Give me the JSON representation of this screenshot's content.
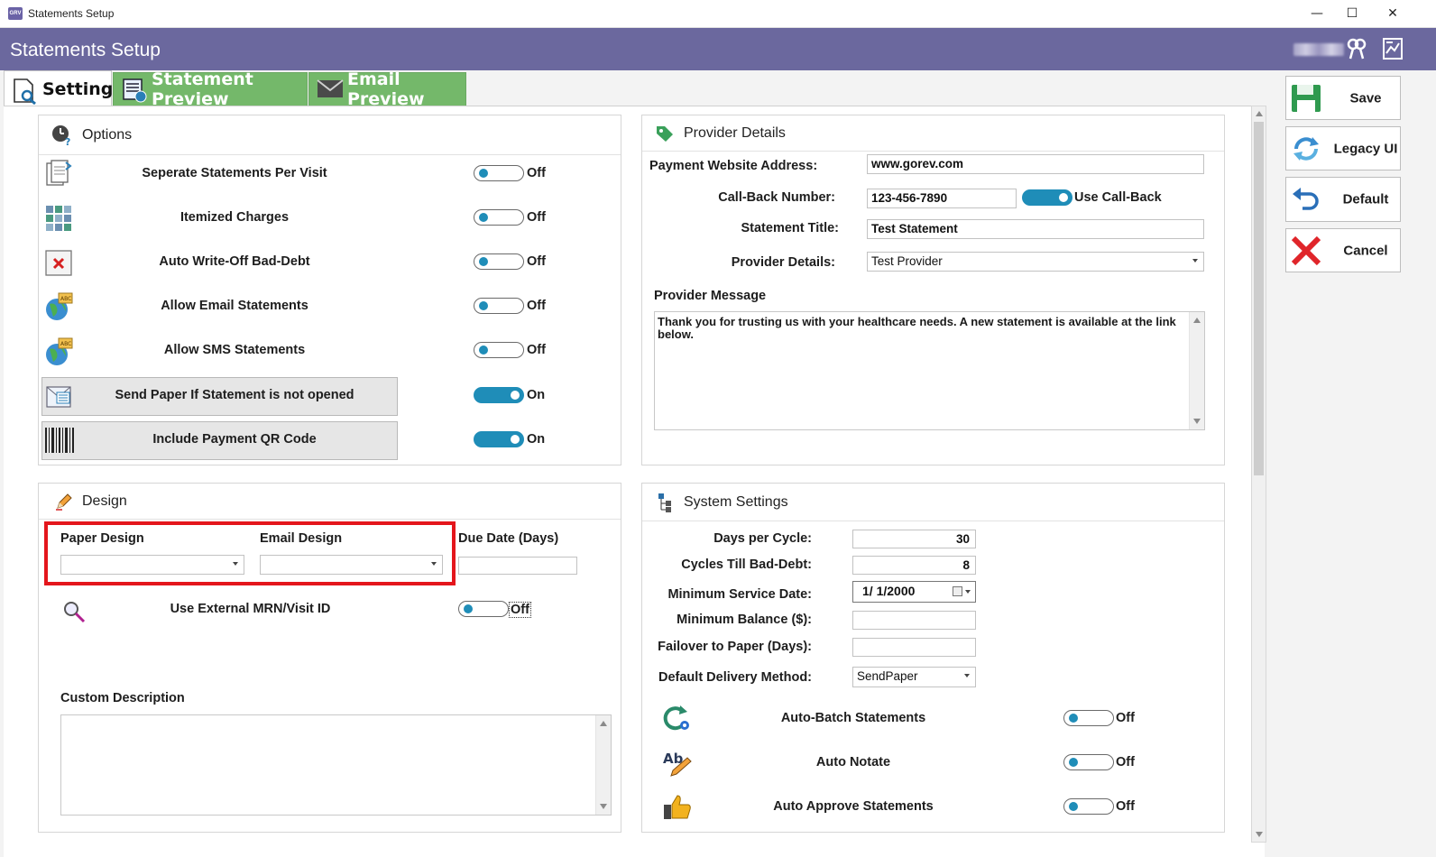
{
  "window": {
    "title": "Statements Setup",
    "app_icon_text": "GRV",
    "minimize": "—",
    "maximize": "☐",
    "close": "✕"
  },
  "header": {
    "title": "Statements Setup"
  },
  "tabs": [
    {
      "label": "Settings"
    },
    {
      "label": "Statement Preview"
    },
    {
      "label": "Email Preview"
    }
  ],
  "options": {
    "title": "Options",
    "rows": [
      {
        "label": "Seperate Statements Per Visit",
        "state": "Off",
        "on": false
      },
      {
        "label": "Itemized Charges",
        "state": "Off",
        "on": false
      },
      {
        "label": "Auto Write-Off Bad-Debt",
        "state": "Off",
        "on": false
      },
      {
        "label": "Allow Email Statements",
        "state": "Off",
        "on": false
      },
      {
        "label": "Allow SMS Statements",
        "state": "Off",
        "on": false
      },
      {
        "label": "Send Paper If Statement is not opened",
        "state": "On",
        "on": true
      },
      {
        "label": "Include Payment QR Code",
        "state": "On",
        "on": true
      }
    ]
  },
  "provider": {
    "title": "Provider Details",
    "payment_website_label": "Payment Website Address:",
    "payment_website_value": "www.gorev.com",
    "callback_label": "Call-Back Number:",
    "callback_value": "123-456-7890",
    "use_callback_label": "Use Call-Back",
    "use_callback_on": true,
    "statement_title_label": "Statement Title:",
    "statement_title_value": "Test Statement",
    "provider_details_label": "Provider Details:",
    "provider_details_value": "Test Provider",
    "message_label": "Provider Message",
    "message_value": "Thank you for trusting us with your healthcare needs.  A new statement is available at the link below."
  },
  "design": {
    "title": "Design",
    "paper_design_label": "Paper Design",
    "paper_design_value": "",
    "email_design_label": "Email Design",
    "email_design_value": "",
    "due_date_label": "Due Date (Days)",
    "due_date_value": "",
    "external_mrn_label": "Use External MRN/Visit ID",
    "external_mrn_state": "Off",
    "external_mrn_on": false,
    "custom_description_label": "Custom Description",
    "custom_description_value": ""
  },
  "system": {
    "title": "System Settings",
    "days_per_cycle_label": "Days per Cycle:",
    "days_per_cycle_value": "30",
    "cycles_bad_debt_label": "Cycles Till Bad-Debt:",
    "cycles_bad_debt_value": "8",
    "min_service_date_label": "Minimum Service Date:",
    "min_service_date_value": "1/  1/2000",
    "min_balance_label": "Minimum Balance ($):",
    "min_balance_value": "",
    "failover_label": "Failover to Paper (Days):",
    "failover_value": "",
    "delivery_label": "Default Delivery Method:",
    "delivery_value": "SendPaper",
    "rows": [
      {
        "label": "Auto-Batch Statements",
        "state": "Off",
        "on": false
      },
      {
        "label": "Auto Notate",
        "state": "Off",
        "on": false
      },
      {
        "label": "Auto Approve Statements",
        "state": "Off",
        "on": false
      }
    ]
  },
  "actions": {
    "save": "Save",
    "legacy": "Legacy UI",
    "default": "Default",
    "cancel": "Cancel"
  },
  "colors": {
    "header": "#6b689e",
    "tab_green": "#74b86a",
    "toggle_blue": "#1f8db8",
    "highlight_red": "#e4161c"
  }
}
